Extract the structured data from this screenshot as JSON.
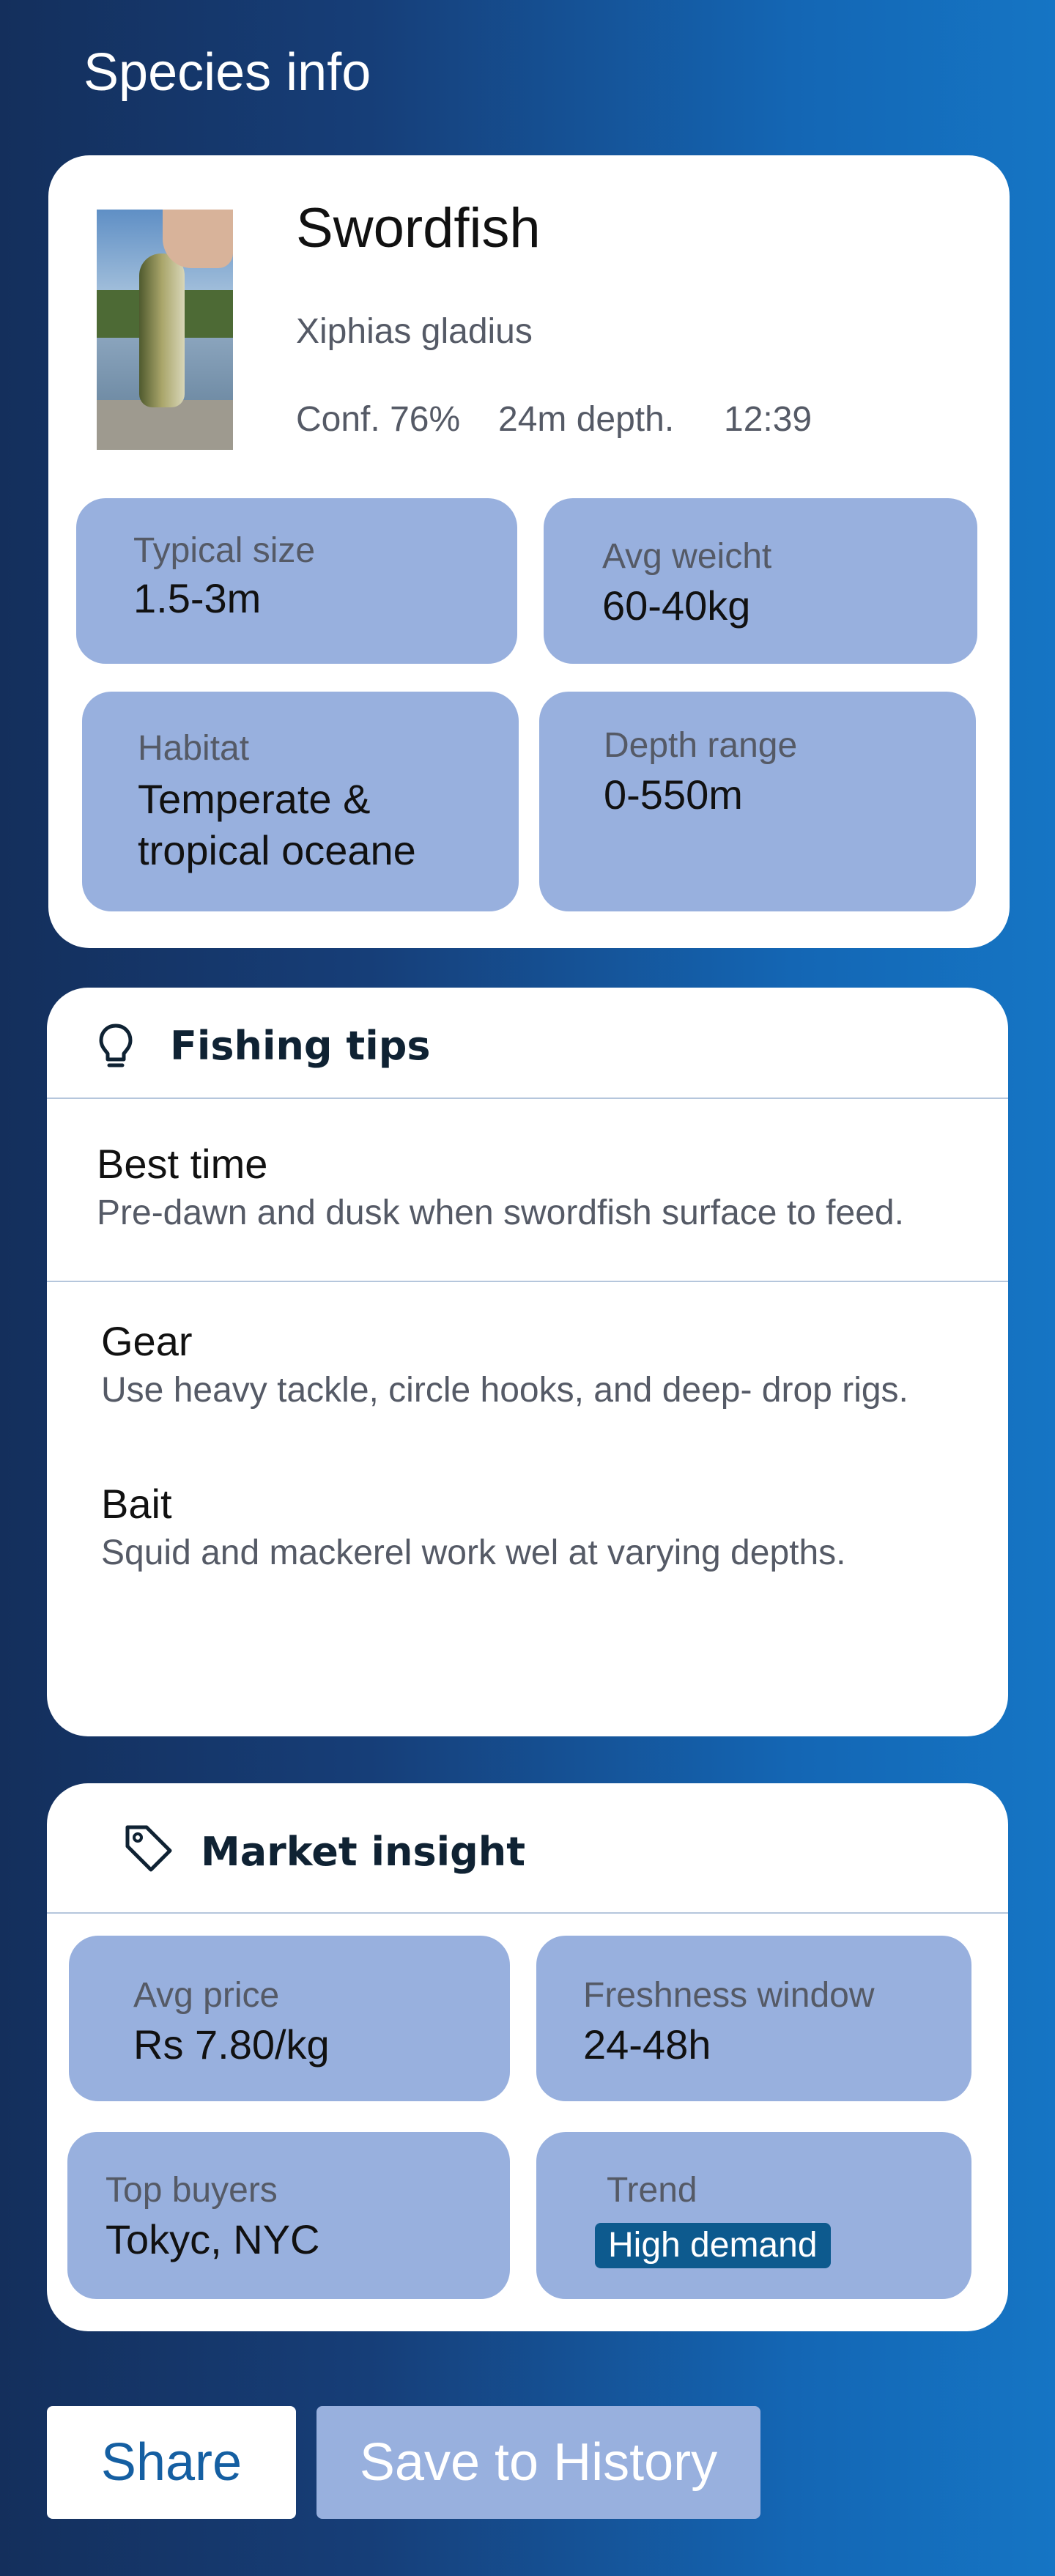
{
  "header": {
    "title": "Species info"
  },
  "species": {
    "name": "Swordfish",
    "scientific_name": "Xiphias gladius",
    "confidence": "Conf. 76%",
    "depth": "24m depth.",
    "time": "12:39",
    "photo_icon": "fish-photo"
  },
  "stats": {
    "typical_size": {
      "label": "Typical size",
      "value": "1.5-3m"
    },
    "avg_weight": {
      "label": "Avg weicht",
      "value": "60-40kg"
    },
    "habitat": {
      "label": "Habitat",
      "value": "Temperate &",
      "value_line2": "tropical oceane"
    },
    "depth_range": {
      "label": "Depth range",
      "value": "0-550m"
    }
  },
  "fishing_tips": {
    "title": "Fishing tips",
    "icon": "lightbulb-icon",
    "items": [
      {
        "title": "Best time",
        "text": "Pre-dawn and dusk when swordfish surface to feed."
      },
      {
        "title": "Gear",
        "text": "Use heavy tackle, circle hooks, and deep- drop rigs."
      },
      {
        "title": "Bait",
        "text": "Squid and mackerel work wel at varying depths."
      }
    ]
  },
  "market": {
    "title": "Market insight",
    "icon": "tag-icon",
    "avg_price": {
      "label": "Avg price",
      "value": "Rs 7.80/kg"
    },
    "freshness": {
      "label": "Freshness window",
      "value": "24-48h"
    },
    "top_buyers": {
      "label": "Top buyers",
      "value": "Tokyc, NYC"
    },
    "trend": {
      "label": "Trend",
      "badge": "High demand"
    }
  },
  "actions": {
    "share_label": "Share",
    "save_label": "Save to History"
  },
  "colors": {
    "tile": "#98b0de",
    "badge": "#0d5a8e",
    "share_text": "#155fa2"
  }
}
